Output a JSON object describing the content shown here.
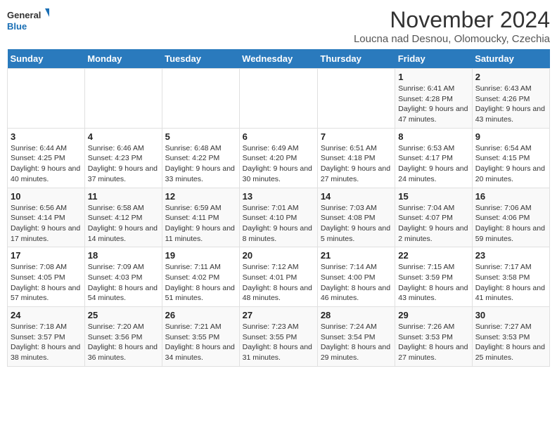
{
  "logo": {
    "line1": "General",
    "line2": "Blue"
  },
  "header": {
    "month_title": "November 2024",
    "subtitle": "Loucna nad Desnou, Olomoucky, Czechia"
  },
  "weekdays": [
    "Sunday",
    "Monday",
    "Tuesday",
    "Wednesday",
    "Thursday",
    "Friday",
    "Saturday"
  ],
  "weeks": [
    [
      {
        "day": "",
        "info": ""
      },
      {
        "day": "",
        "info": ""
      },
      {
        "day": "",
        "info": ""
      },
      {
        "day": "",
        "info": ""
      },
      {
        "day": "",
        "info": ""
      },
      {
        "day": "1",
        "info": "Sunrise: 6:41 AM\nSunset: 4:28 PM\nDaylight: 9 hours and 47 minutes."
      },
      {
        "day": "2",
        "info": "Sunrise: 6:43 AM\nSunset: 4:26 PM\nDaylight: 9 hours and 43 minutes."
      }
    ],
    [
      {
        "day": "3",
        "info": "Sunrise: 6:44 AM\nSunset: 4:25 PM\nDaylight: 9 hours and 40 minutes."
      },
      {
        "day": "4",
        "info": "Sunrise: 6:46 AM\nSunset: 4:23 PM\nDaylight: 9 hours and 37 minutes."
      },
      {
        "day": "5",
        "info": "Sunrise: 6:48 AM\nSunset: 4:22 PM\nDaylight: 9 hours and 33 minutes."
      },
      {
        "day": "6",
        "info": "Sunrise: 6:49 AM\nSunset: 4:20 PM\nDaylight: 9 hours and 30 minutes."
      },
      {
        "day": "7",
        "info": "Sunrise: 6:51 AM\nSunset: 4:18 PM\nDaylight: 9 hours and 27 minutes."
      },
      {
        "day": "8",
        "info": "Sunrise: 6:53 AM\nSunset: 4:17 PM\nDaylight: 9 hours and 24 minutes."
      },
      {
        "day": "9",
        "info": "Sunrise: 6:54 AM\nSunset: 4:15 PM\nDaylight: 9 hours and 20 minutes."
      }
    ],
    [
      {
        "day": "10",
        "info": "Sunrise: 6:56 AM\nSunset: 4:14 PM\nDaylight: 9 hours and 17 minutes."
      },
      {
        "day": "11",
        "info": "Sunrise: 6:58 AM\nSunset: 4:12 PM\nDaylight: 9 hours and 14 minutes."
      },
      {
        "day": "12",
        "info": "Sunrise: 6:59 AM\nSunset: 4:11 PM\nDaylight: 9 hours and 11 minutes."
      },
      {
        "day": "13",
        "info": "Sunrise: 7:01 AM\nSunset: 4:10 PM\nDaylight: 9 hours and 8 minutes."
      },
      {
        "day": "14",
        "info": "Sunrise: 7:03 AM\nSunset: 4:08 PM\nDaylight: 9 hours and 5 minutes."
      },
      {
        "day": "15",
        "info": "Sunrise: 7:04 AM\nSunset: 4:07 PM\nDaylight: 9 hours and 2 minutes."
      },
      {
        "day": "16",
        "info": "Sunrise: 7:06 AM\nSunset: 4:06 PM\nDaylight: 8 hours and 59 minutes."
      }
    ],
    [
      {
        "day": "17",
        "info": "Sunrise: 7:08 AM\nSunset: 4:05 PM\nDaylight: 8 hours and 57 minutes."
      },
      {
        "day": "18",
        "info": "Sunrise: 7:09 AM\nSunset: 4:03 PM\nDaylight: 8 hours and 54 minutes."
      },
      {
        "day": "19",
        "info": "Sunrise: 7:11 AM\nSunset: 4:02 PM\nDaylight: 8 hours and 51 minutes."
      },
      {
        "day": "20",
        "info": "Sunrise: 7:12 AM\nSunset: 4:01 PM\nDaylight: 8 hours and 48 minutes."
      },
      {
        "day": "21",
        "info": "Sunrise: 7:14 AM\nSunset: 4:00 PM\nDaylight: 8 hours and 46 minutes."
      },
      {
        "day": "22",
        "info": "Sunrise: 7:15 AM\nSunset: 3:59 PM\nDaylight: 8 hours and 43 minutes."
      },
      {
        "day": "23",
        "info": "Sunrise: 7:17 AM\nSunset: 3:58 PM\nDaylight: 8 hours and 41 minutes."
      }
    ],
    [
      {
        "day": "24",
        "info": "Sunrise: 7:18 AM\nSunset: 3:57 PM\nDaylight: 8 hours and 38 minutes."
      },
      {
        "day": "25",
        "info": "Sunrise: 7:20 AM\nSunset: 3:56 PM\nDaylight: 8 hours and 36 minutes."
      },
      {
        "day": "26",
        "info": "Sunrise: 7:21 AM\nSunset: 3:55 PM\nDaylight: 8 hours and 34 minutes."
      },
      {
        "day": "27",
        "info": "Sunrise: 7:23 AM\nSunset: 3:55 PM\nDaylight: 8 hours and 31 minutes."
      },
      {
        "day": "28",
        "info": "Sunrise: 7:24 AM\nSunset: 3:54 PM\nDaylight: 8 hours and 29 minutes."
      },
      {
        "day": "29",
        "info": "Sunrise: 7:26 AM\nSunset: 3:53 PM\nDaylight: 8 hours and 27 minutes."
      },
      {
        "day": "30",
        "info": "Sunrise: 7:27 AM\nSunset: 3:53 PM\nDaylight: 8 hours and 25 minutes."
      }
    ]
  ]
}
